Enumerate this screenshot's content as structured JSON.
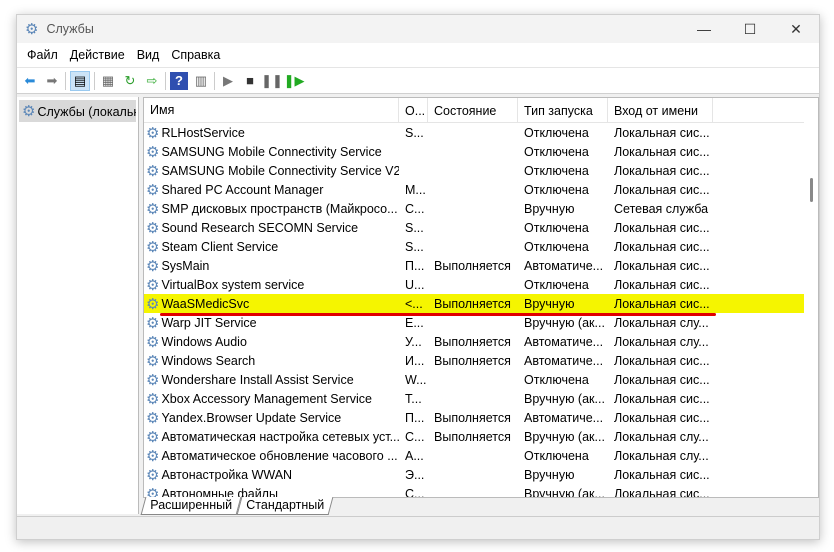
{
  "window": {
    "title": "Службы",
    "controls": [
      "—",
      "☐",
      "✕"
    ]
  },
  "menu": [
    "Файл",
    "Действие",
    "Вид",
    "Справка"
  ],
  "toolbar": [
    "back",
    "forward",
    "show-tree",
    "properties",
    "refresh",
    "export",
    "help",
    "console",
    "start",
    "stop",
    "pause",
    "restart"
  ],
  "tree": {
    "item": "Службы (локальные)"
  },
  "columns": [
    "Имя",
    "О...",
    "Состояние",
    "Тип запуска",
    "Вход от имени"
  ],
  "rows": [
    [
      "RLHostService",
      "S...",
      "",
      "Отключена",
      "Локальная сис..."
    ],
    [
      "SAMSUNG Mobile Connectivity Service",
      "",
      "",
      "Отключена",
      "Локальная сис..."
    ],
    [
      "SAMSUNG Mobile Connectivity Service V2",
      "",
      "",
      "Отключена",
      "Локальная сис..."
    ],
    [
      "Shared PC Account Manager",
      "M...",
      "",
      "Отключена",
      "Локальная сис..."
    ],
    [
      "SMP дисковых пространств (Майкросо...",
      "С...",
      "",
      "Вручную",
      "Сетевая служба"
    ],
    [
      "Sound Research SECOMN Service",
      "S...",
      "",
      "Отключена",
      "Локальная сис..."
    ],
    [
      "Steam Client Service",
      "S...",
      "",
      "Отключена",
      "Локальная сис..."
    ],
    [
      "SysMain",
      "П...",
      "Выполняется",
      "Автоматиче...",
      "Локальная сис..."
    ],
    [
      "VirtualBox system service",
      "U...",
      "",
      "Отключена",
      "Локальная сис..."
    ],
    [
      "WaaSMedicSvc",
      "<...",
      "Выполняется",
      "Вручную",
      "Локальная сис..."
    ],
    [
      "Warp JIT Service",
      "E...",
      "",
      "Вручную (ак...",
      "Локальная слу..."
    ],
    [
      "Windows Audio",
      "У...",
      "Выполняется",
      "Автоматиче...",
      "Локальная слу..."
    ],
    [
      "Windows Search",
      "И...",
      "Выполняется",
      "Автоматиче...",
      "Локальная сис..."
    ],
    [
      "Wondershare Install Assist Service",
      "W...",
      "",
      "Отключена",
      "Локальная сис..."
    ],
    [
      "Xbox Accessory Management Service",
      "T...",
      "",
      "Вручную (ак...",
      "Локальная сис..."
    ],
    [
      "Yandex.Browser Update Service",
      "П...",
      "Выполняется",
      "Автоматиче...",
      "Локальная сис..."
    ],
    [
      "Автоматическая настройка сетевых уст...",
      "С...",
      "Выполняется",
      "Вручную (ак...",
      "Локальная слу..."
    ],
    [
      "Автоматическое обновление часового ...",
      "А...",
      "",
      "Отключена",
      "Локальная слу..."
    ],
    [
      "Автонастройка WWAN",
      "Э...",
      "",
      "Вручную",
      "Локальная сис..."
    ],
    [
      "Автономные файлы",
      "С...",
      "",
      "Вручную (ак...",
      "Локальная сис..."
    ]
  ],
  "highlighted_row": "WaaSMedicSvc",
  "tabs": [
    "Расширенный",
    "Стандартный"
  ]
}
